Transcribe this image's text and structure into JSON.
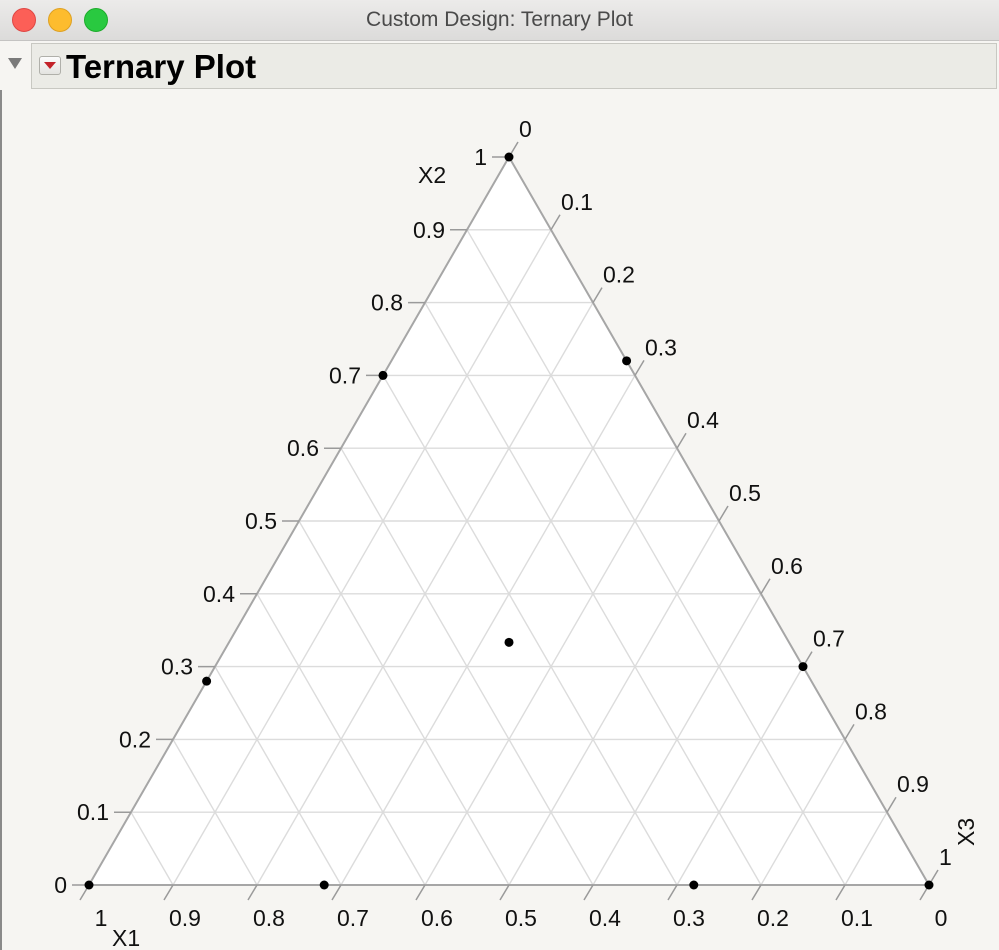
{
  "window": {
    "title": "Custom Design: Ternary Plot"
  },
  "report": {
    "title": "Ternary Plot"
  },
  "chart_data": {
    "type": "ternary",
    "axes": [
      "X1",
      "X2",
      "X3"
    ],
    "axis_labels": [
      "X1",
      "X2",
      "X3"
    ],
    "ticks": [
      "0",
      "0.1",
      "0.2",
      "0.3",
      "0.4",
      "0.5",
      "0.6",
      "0.7",
      "0.8",
      "0.9",
      "1"
    ],
    "grid": true,
    "points": [
      {
        "X1": 1,
        "X2": 0,
        "X3": 0
      },
      {
        "X1": 0,
        "X2": 0,
        "X3": 1
      },
      {
        "X1": 0,
        "X2": 1,
        "X3": 0
      },
      {
        "X1": 0.333,
        "X2": 0.333,
        "X3": 0.333
      },
      {
        "X1": 0.72,
        "X2": 0.28,
        "X3": 0
      },
      {
        "X1": 0.3,
        "X2": 0.7,
        "X3": 0
      },
      {
        "X1": 0,
        "X2": 0.3,
        "X3": 0.7
      },
      {
        "X1": 0,
        "X2": 0.72,
        "X3": 0.28
      },
      {
        "X1": 0.72,
        "X2": 0,
        "X3": 0.28
      },
      {
        "X1": 0.28,
        "X2": 0,
        "X3": 0.72
      }
    ]
  }
}
